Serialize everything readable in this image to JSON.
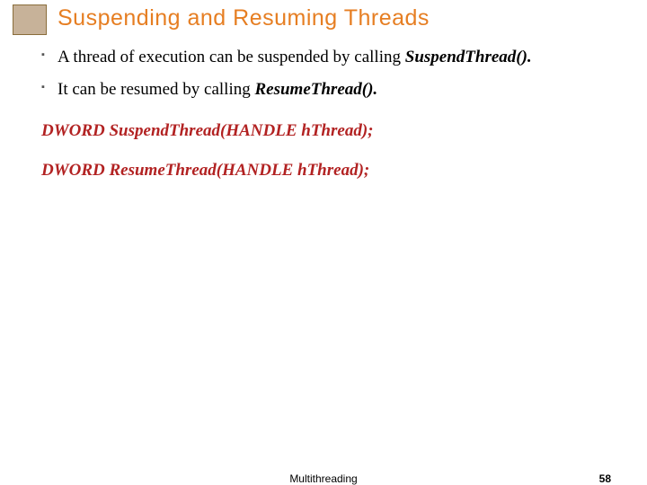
{
  "title": "Suspending and Resuming Threads",
  "bullets": {
    "b1_prefix": "A thread of execution can be suspended by calling ",
    "b1_em": "SuspendThread().",
    "b2_prefix": "It can be resumed by calling ",
    "b2_em": "ResumeThread().",
    "b2_suffix": ""
  },
  "signatures": {
    "suspend": "DWORD SuspendThread(HANDLE hThread);",
    "resume": "DWORD ResumeThread(HANDLE hThread);"
  },
  "footer": {
    "center": "Multithreading",
    "page": "58"
  }
}
